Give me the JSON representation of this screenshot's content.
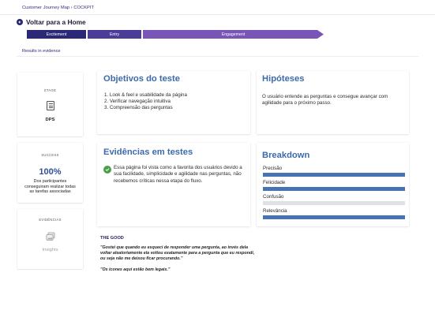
{
  "breadcrumb": "Customer Journey Map › COCKPIT",
  "back": {
    "label": "Voltar para a Home",
    "icon": "arrow-left-icon"
  },
  "stages": [
    "Excitement",
    "Entry",
    "Engagement"
  ],
  "results_label": "Results in evidence",
  "stage_card": {
    "title": "STAGE",
    "value": "DPS",
    "icon": "document-icon"
  },
  "success_card": {
    "title": "SUCCESS",
    "percent": "100%",
    "description": "Dos participantes conseguiram realizar todas as tarefas associadas"
  },
  "evidence_card": {
    "title": "EVIDÊNCIAS",
    "label": "Insights",
    "icon": "images-icon"
  },
  "objectives": {
    "title": "Objetivos do teste",
    "items": [
      "1. Look & feel e usabilidade da página",
      "2. Verificar navegação intuitiva",
      "3. Compreensão das perguntas"
    ]
  },
  "hypotheses": {
    "title": "Hipóteses",
    "text": "O usuário entende as perguntas e consegue avançar com agilidade para o próximo passo."
  },
  "evidence": {
    "title": "Evidências em testes",
    "icon": "check-circle-icon",
    "text": "Essa página foi vista como a favorita dos usuários devido a sua facilidade, simplicidade e agilidade nas perguntas, não recebemos críticas nessa etapa do fluxo."
  },
  "breakdown": {
    "title": "Breakdown",
    "items": [
      {
        "label": "Precisão",
        "value": 1.0
      },
      {
        "label": "Felicidade",
        "value": 1.0
      },
      {
        "label": "Confusão",
        "value": 0.0
      },
      {
        "label": "Relevância",
        "value": 1.0
      }
    ],
    "bar_color": "#4573b3"
  },
  "the_good": {
    "title": "THE GOOD",
    "quotes": [
      "\"Gostei que quando eu esqueci de responder uma pergunta, ao invés dela voltar aleatoriamente ela voltou exatamente para a pergunta que eu respondi, ou seja não me deixou ficar procurando.\"",
      "\"Os ícones aqui estão bem legais.\""
    ]
  }
}
